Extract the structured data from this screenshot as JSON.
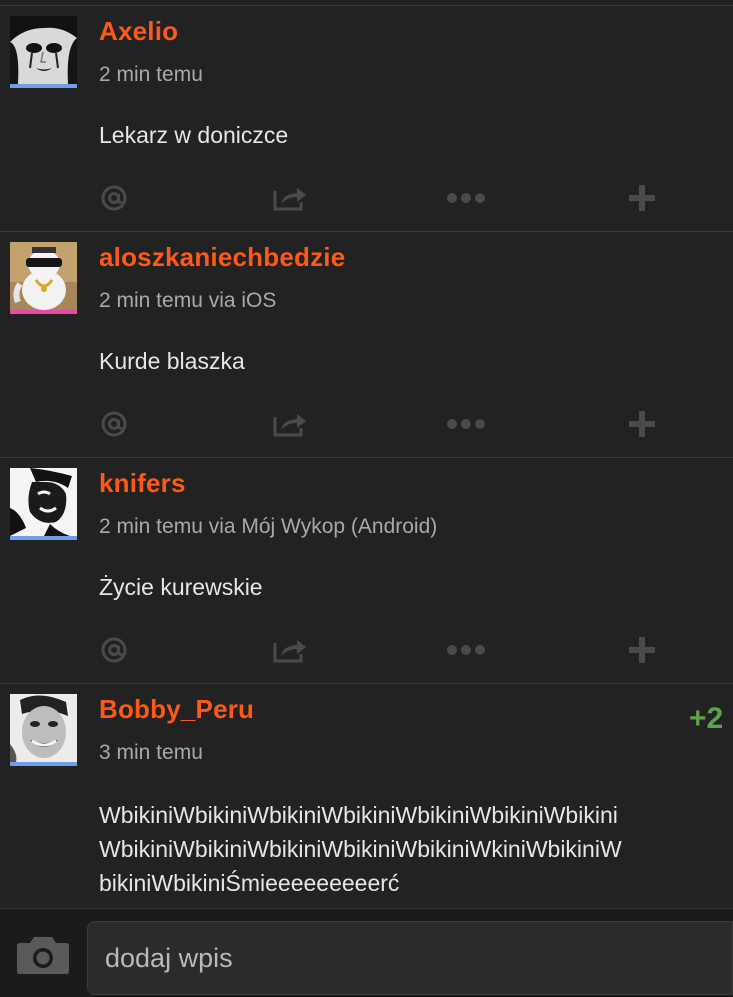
{
  "colors": {
    "background": "#222223",
    "username": "#ff5917",
    "meta": "#a9a9ab",
    "vote_positive": "#5fa14b",
    "bar_blue": "#6f9fe6",
    "bar_pink": "#e84aa6"
  },
  "entries": [
    {
      "author": "Axelio",
      "meta": "2 min temu",
      "body": "Lekarz w doniczce",
      "avatar_bar": "blue",
      "actions": [
        "mention-icon",
        "share-icon",
        "more-icon",
        "plus-icon"
      ]
    },
    {
      "author": "aloszkaniechbedzie",
      "meta": "2 min temu via iOS",
      "body": "Kurde blaszka",
      "avatar_bar": "pink",
      "actions": [
        "mention-icon",
        "share-icon",
        "more-icon",
        "plus-icon"
      ]
    },
    {
      "author": "knifers",
      "meta": "2 min temu via Mój Wykop (Android)",
      "body": "Życie kurewskie",
      "avatar_bar": "blue",
      "actions": [
        "mention-icon",
        "share-icon",
        "more-icon",
        "plus-icon"
      ]
    },
    {
      "author": "Bobby_Peru",
      "meta": "3 min temu",
      "vote": "+2",
      "body_lines": [
        "WbikiniWbikiniWbikiniWbikiniWbikiniWbikiniWbikini",
        "WbikiniWbikiniWbikiniWbikiniWbikiniWkiniWbikiniW",
        "bikiniWbikiniŚmieeeeeeeeerć"
      ],
      "avatar_bar": "blue"
    }
  ],
  "composer": {
    "camera_icon": "camera-icon",
    "placeholder": "dodaj wpis"
  }
}
